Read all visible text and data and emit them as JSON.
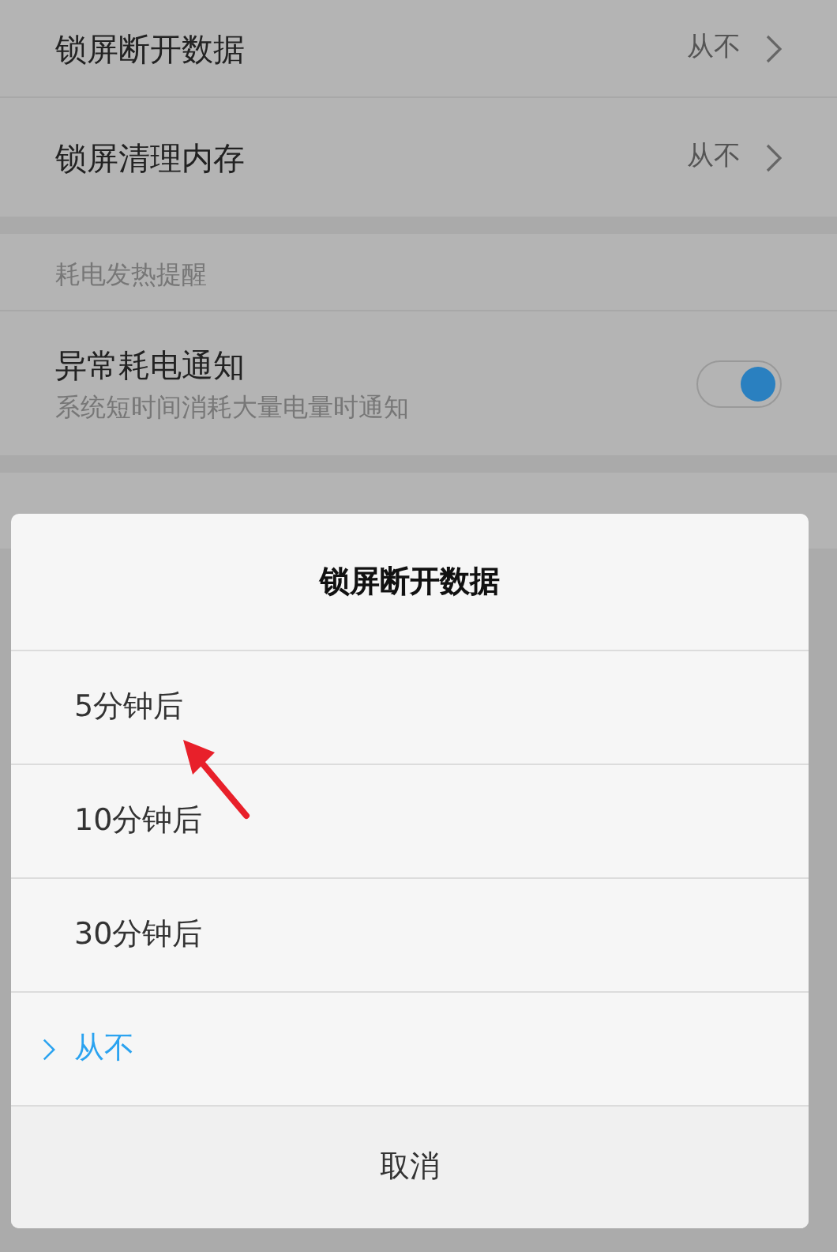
{
  "settings": [
    {
      "kind": "link",
      "label": "锁屏断开数据",
      "value": "从不"
    },
    {
      "kind": "link",
      "label": "锁屏清理内存",
      "value": "从不"
    },
    {
      "kind": "header",
      "label": "耗电发热提醒"
    },
    {
      "kind": "toggle",
      "label": "异常耗电通知",
      "description": "系统短时间消耗大量电量时通知",
      "on": true
    }
  ],
  "dialog": {
    "title": "锁屏断开数据",
    "options": [
      {
        "label": "5分钟后",
        "selected": false
      },
      {
        "label": "10分钟后",
        "selected": false
      },
      {
        "label": "30分钟后",
        "selected": false
      },
      {
        "label": "从不",
        "selected": true
      }
    ],
    "cancel": "取消"
  }
}
